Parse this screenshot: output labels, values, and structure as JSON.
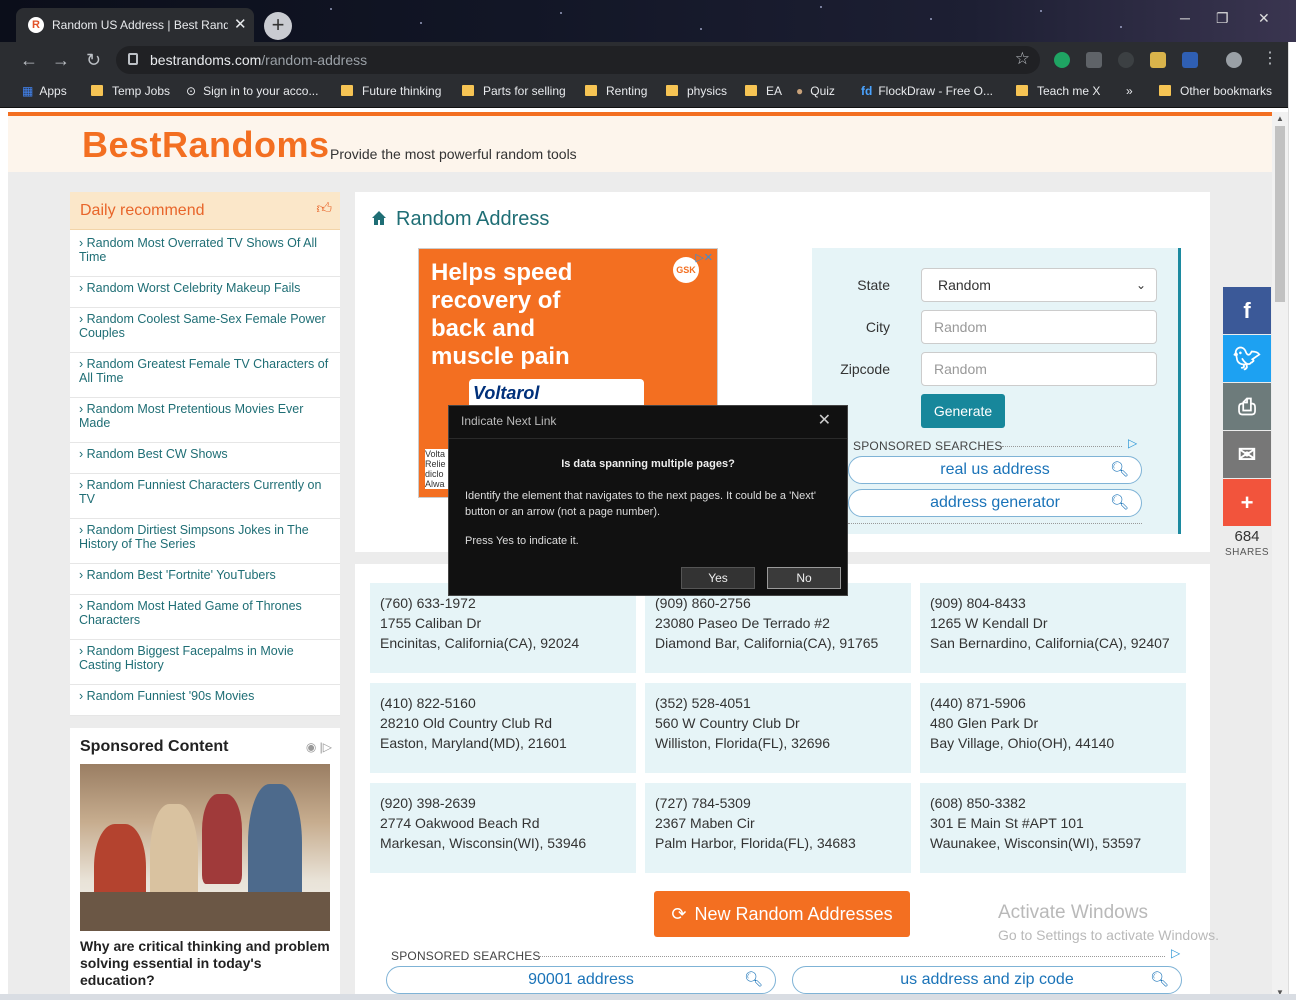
{
  "browser": {
    "tab_title": "Random US Address | Best Rand",
    "tab_close": "✕",
    "new_tab": "+",
    "url_domain": "bestrandoms.com",
    "url_path": "/random-address",
    "bookmarks": [
      {
        "label": "Apps"
      },
      {
        "label": "Temp Jobs"
      },
      {
        "label": "Sign in to your acco..."
      },
      {
        "label": "Future thinking"
      },
      {
        "label": "Parts for selling"
      },
      {
        "label": "Renting"
      },
      {
        "label": "physics"
      },
      {
        "label": "EA"
      },
      {
        "label": "Quiz"
      },
      {
        "label": "FlockDraw - Free O..."
      },
      {
        "label": "Teach me X"
      },
      {
        "label": "»"
      },
      {
        "label": "Other bookmarks"
      }
    ]
  },
  "site": {
    "logo": "BestRandoms",
    "slogan": "Provide the most powerful random tools"
  },
  "sidebar": {
    "title": "Daily recommend",
    "items": [
      "› Random Most Overrated TV Shows Of All Time",
      "› Random Worst Celebrity Makeup Fails",
      "› Random Coolest Same-Sex Female Power Couples",
      "› Random Greatest Female TV Characters of All Time",
      "› Random Most Pretentious Movies Ever Made",
      "› Random Best CW Shows",
      "› Random Funniest Characters Currently on TV",
      "› Random Dirtiest Simpsons Jokes in The History of The Series",
      "› Random Best 'Fortnite' YouTubers",
      "› Random Most Hated Game of Thrones Characters",
      "› Random Biggest Facepalms in Movie Casting History",
      "› Random Funniest '90s Movies"
    ],
    "sponsored_title": "Sponsored Content",
    "sponsored_caption": "Why are critical thinking and problem solving essential in today's education?"
  },
  "main": {
    "title": "Random Address",
    "ad": {
      "headline": "Helps speed recovery of back and muscle pain",
      "brand": "Voltarol",
      "badge": "GSK",
      "small": "Volta Relie diclo Alwa"
    },
    "form": {
      "state_label": "State",
      "state_value": "Random",
      "city_label": "City",
      "city_placeholder": "Random",
      "zip_label": "Zipcode",
      "zip_placeholder": "Random",
      "generate": "Generate"
    },
    "sponsored_searches_label": "SPONSORED SEARCHES",
    "sponsored_top": [
      "real us address",
      "address generator"
    ],
    "sponsored_bottom": [
      "90001 address",
      "us address and zip code"
    ],
    "addresses": [
      {
        "phone": "(760) 633-1972",
        "street": "1755 Caliban Dr",
        "city": "Encinitas, California(CA), 92024"
      },
      {
        "phone": "(909) 860-2756",
        "street": "23080 Paseo De Terrado #2",
        "city": "Diamond Bar, California(CA), 91765"
      },
      {
        "phone": "(909) 804-8433",
        "street": "1265 W Kendall Dr",
        "city": "San Bernardino, California(CA), 92407"
      },
      {
        "phone": "(410) 822-5160",
        "street": "28210 Old Country Club Rd",
        "city": "Easton, Maryland(MD), 21601"
      },
      {
        "phone": "(352) 528-4051",
        "street": "560 W Country Club Dr",
        "city": "Williston, Florida(FL), 32696"
      },
      {
        "phone": "(440) 871-5906",
        "street": "480 Glen Park Dr",
        "city": "Bay Village, Ohio(OH), 44140"
      },
      {
        "phone": "(920) 398-2639",
        "street": "2774 Oakwood Beach Rd",
        "city": "Markesan, Wisconsin(WI), 53946"
      },
      {
        "phone": "(727) 784-5309",
        "street": "2367 Maben Cir",
        "city": "Palm Harbor, Florida(FL), 34683"
      },
      {
        "phone": "(608) 850-3382",
        "street": "301 E Main St #APT 101",
        "city": "Waunakee, Wisconsin(WI), 53597"
      }
    ],
    "new_button": "New Random Addresses"
  },
  "social": {
    "share_count": "684",
    "share_label": "SHARES",
    "colors": {
      "facebook": "#3b5998",
      "twitter": "#1da1f2",
      "print": "#6d7b7b",
      "email": "#777777",
      "more": "#f2543c"
    }
  },
  "activate_windows": {
    "title": "Activate Windows",
    "subtitle": "Go to Settings to activate Windows."
  },
  "dialog": {
    "title": "Indicate Next Link",
    "question": "Is data spanning multiple pages?",
    "body": "Identify the element that navigates to the next pages. It could be a 'Next' button or an arrow (not a page number).",
    "body2": "Press Yes to indicate it.",
    "yes": "Yes",
    "no": "No"
  },
  "colors": {
    "brand": "#f36f21",
    "teal": "#1f6e75",
    "accent": "#17879b"
  }
}
